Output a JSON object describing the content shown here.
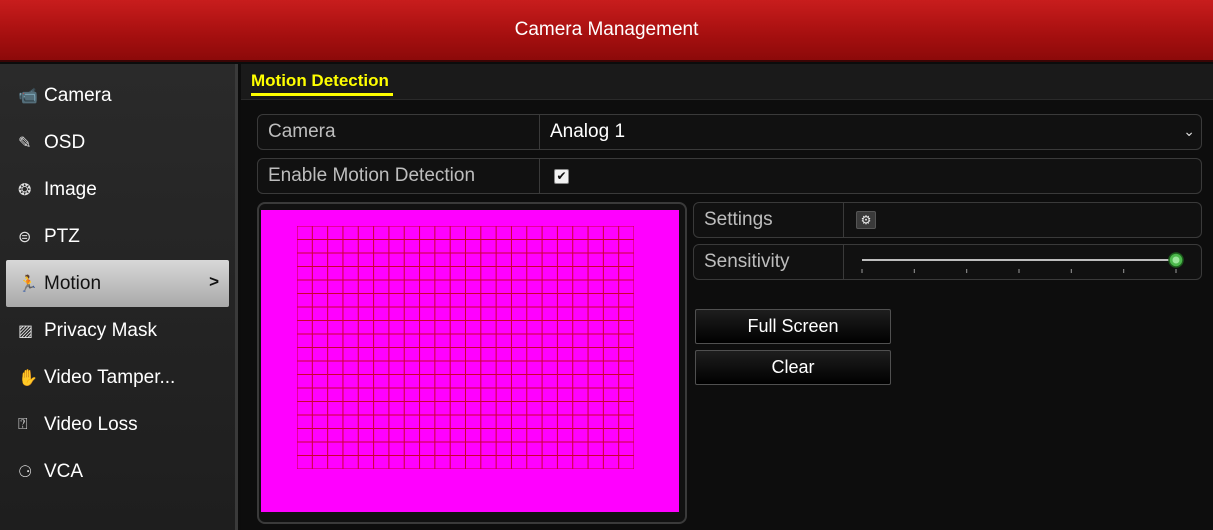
{
  "window": {
    "title": "Camera Management"
  },
  "sidebar": {
    "items": [
      {
        "label": "Camera",
        "icon": "camera-icon",
        "glyph": "📹"
      },
      {
        "label": "OSD",
        "icon": "osd-icon",
        "glyph": "✎"
      },
      {
        "label": "Image",
        "icon": "image-icon",
        "glyph": "❂"
      },
      {
        "label": "PTZ",
        "icon": "ptz-icon",
        "glyph": "⊜"
      },
      {
        "label": "Motion",
        "icon": "motion-icon",
        "glyph": "🏃",
        "active": true
      },
      {
        "label": "Privacy Mask",
        "icon": "privacy-mask-icon",
        "glyph": "▨"
      },
      {
        "label": "Video Tamper...",
        "icon": "video-tamper-icon",
        "glyph": "✋"
      },
      {
        "label": "Video Loss",
        "icon": "video-loss-icon",
        "glyph": "⍰"
      },
      {
        "label": "VCA",
        "icon": "vca-icon",
        "glyph": "⚆"
      }
    ],
    "active_arrow": ">"
  },
  "main": {
    "tab": "Motion Detection",
    "camera": {
      "label": "Camera",
      "value": "Analog 1"
    },
    "enable": {
      "label": "Enable Motion Detection",
      "checked": true,
      "check_glyph": "✔"
    },
    "settings": {
      "label": "Settings",
      "gear_glyph": "⚙"
    },
    "sensitivity": {
      "label": "Sensitivity",
      "level": 1.0
    },
    "buttons": {
      "full_screen": "Full Screen",
      "clear": "Clear"
    }
  },
  "colors": {
    "title_bar": "#b51515",
    "tab_accent": "#ffff00",
    "preview_bg": "#ff00ff",
    "grid_line": "#cc0033",
    "slider_knob": "#4cb84c"
  }
}
